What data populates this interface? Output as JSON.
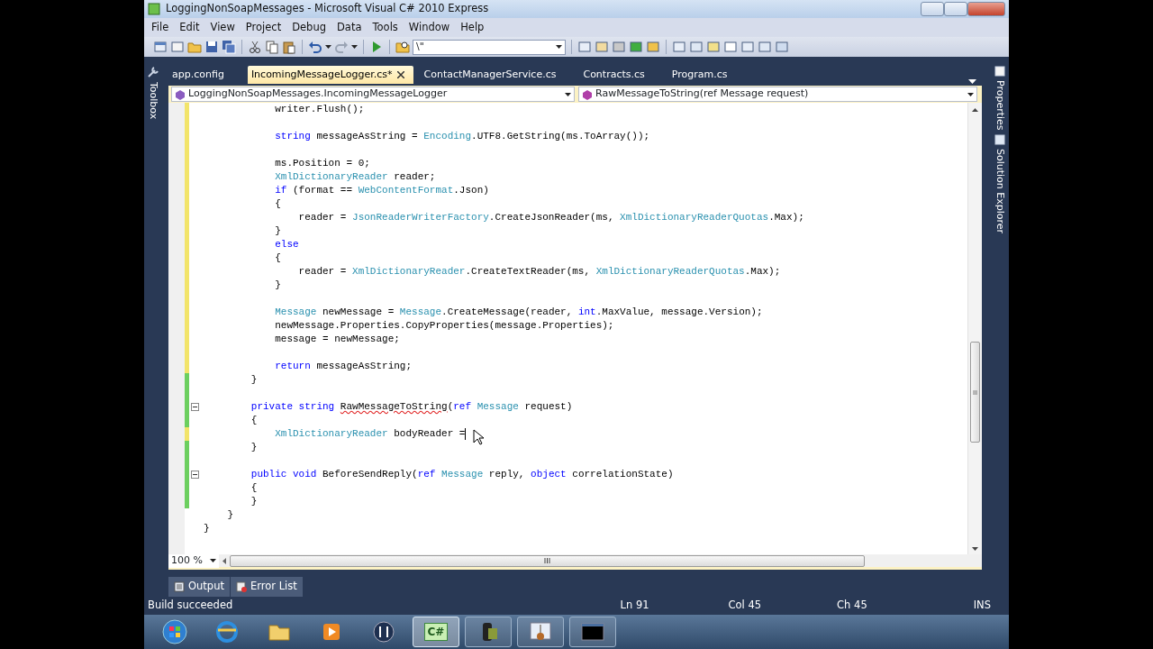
{
  "window": {
    "title": "LoggingNonSoapMessages - Microsoft Visual C# 2010 Express"
  },
  "menu": [
    "File",
    "Edit",
    "View",
    "Project",
    "Debug",
    "Data",
    "Tools",
    "Window",
    "Help"
  ],
  "toolbar": {
    "combo_value": "\\\""
  },
  "side_panels": {
    "left": [
      "Toolbox"
    ],
    "right": [
      "Properties",
      "Solution Explorer"
    ]
  },
  "doc_tabs": [
    {
      "label": "app.config",
      "selected": false
    },
    {
      "label": "IncomingMessageLogger.cs*",
      "selected": true
    },
    {
      "label": "ContactManagerService.cs",
      "selected": false
    },
    {
      "label": "Contracts.cs",
      "selected": false
    },
    {
      "label": "Program.cs",
      "selected": false
    }
  ],
  "nav_bar": {
    "type_dropdown": "LoggingNonSoapMessages.IncomingMessageLogger",
    "member_dropdown": "RawMessageToString(ref Message request)"
  },
  "code_lines": [
    {
      "modified": true,
      "saved": false,
      "tokens": [
        {
          "kind": "plain",
          "text": "            writer.Flush();"
        }
      ]
    },
    {
      "modified": true,
      "saved": false
    },
    {
      "modified": true,
      "saved": false,
      "tokens": [
        {
          "kind": "keyword",
          "text": "            string"
        },
        {
          "kind": "plain",
          "text": " messageAsString = "
        },
        {
          "kind": "type",
          "text": "Encoding"
        },
        {
          "kind": "plain",
          "text": ".UTF8.GetString(ms.ToArray());"
        }
      ]
    },
    {
      "modified": true,
      "saved": false
    },
    {
      "modified": true,
      "saved": false,
      "tokens": [
        {
          "kind": "plain",
          "text": "            ms.Position = 0;"
        }
      ]
    },
    {
      "modified": true,
      "saved": false,
      "tokens": [
        {
          "kind": "type",
          "text": "            XmlDictionaryReader"
        },
        {
          "kind": "plain",
          "text": " reader;"
        }
      ]
    },
    {
      "modified": true,
      "saved": false,
      "tokens": [
        {
          "kind": "keyword",
          "text": "            if"
        },
        {
          "kind": "plain",
          "text": " (format == "
        },
        {
          "kind": "type",
          "text": "WebContentFormat"
        },
        {
          "kind": "plain",
          "text": ".Json)"
        }
      ]
    },
    {
      "modified": true,
      "saved": false,
      "tokens": [
        {
          "kind": "plain",
          "text": "            {"
        }
      ]
    },
    {
      "modified": true,
      "saved": false,
      "tokens": [
        {
          "kind": "plain",
          "text": "                reader = "
        },
        {
          "kind": "type",
          "text": "JsonReaderWriterFactory"
        },
        {
          "kind": "plain",
          "text": ".CreateJsonReader(ms, "
        },
        {
          "kind": "type",
          "text": "XmlDictionaryReaderQuotas"
        },
        {
          "kind": "plain",
          "text": ".Max);"
        }
      ]
    },
    {
      "modified": true,
      "saved": false,
      "tokens": [
        {
          "kind": "plain",
          "text": "            }"
        }
      ]
    },
    {
      "modified": true,
      "saved": false,
      "tokens": [
        {
          "kind": "keyword",
          "text": "            else"
        }
      ]
    },
    {
      "modified": true,
      "saved": false,
      "tokens": [
        {
          "kind": "plain",
          "text": "            {"
        }
      ]
    },
    {
      "modified": true,
      "saved": false,
      "tokens": [
        {
          "kind": "plain",
          "text": "                reader = "
        },
        {
          "kind": "type",
          "text": "XmlDictionaryReader"
        },
        {
          "kind": "plain",
          "text": ".CreateTextReader(ms, "
        },
        {
          "kind": "type",
          "text": "XmlDictionaryReaderQuotas"
        },
        {
          "kind": "plain",
          "text": ".Max);"
        }
      ]
    },
    {
      "modified": true,
      "saved": false,
      "tokens": [
        {
          "kind": "plain",
          "text": "            }"
        }
      ]
    },
    {
      "modified": true,
      "saved": false
    },
    {
      "modified": true,
      "saved": false,
      "tokens": [
        {
          "kind": "type",
          "text": "            Message"
        },
        {
          "kind": "plain",
          "text": " newMessage = "
        },
        {
          "kind": "type",
          "text": "Message"
        },
        {
          "kind": "plain",
          "text": ".CreateMessage(reader, "
        },
        {
          "kind": "keyword",
          "text": "int"
        },
        {
          "kind": "plain",
          "text": ".MaxValue, message.Version);"
        }
      ]
    },
    {
      "modified": true,
      "saved": false,
      "tokens": [
        {
          "kind": "plain",
          "text": "            newMessage.Properties.CopyProperties(message.Properties);"
        }
      ]
    },
    {
      "modified": true,
      "saved": false,
      "tokens": [
        {
          "kind": "plain",
          "text": "            message = newMessage;"
        }
      ]
    },
    {
      "modified": true,
      "saved": false
    },
    {
      "modified": true,
      "saved": false,
      "tokens": [
        {
          "kind": "keyword",
          "text": "            return"
        },
        {
          "kind": "plain",
          "text": " messageAsString;"
        }
      ]
    },
    {
      "modified": true,
      "saved": true,
      "tokens": [
        {
          "kind": "plain",
          "text": "        }"
        }
      ]
    },
    {
      "modified": true,
      "saved": true
    },
    {
      "modified": true,
      "saved": true,
      "fold": true,
      "tokens": [
        {
          "kind": "keyword",
          "text": "        private string "
        },
        {
          "kind": "error",
          "text": "RawMessageToString"
        },
        {
          "kind": "plain",
          "text": "("
        },
        {
          "kind": "keyword",
          "text": "ref "
        },
        {
          "kind": "type",
          "text": "Message"
        },
        {
          "kind": "plain",
          "text": " request)"
        }
      ]
    },
    {
      "modified": true,
      "saved": true,
      "tokens": [
        {
          "kind": "plain",
          "text": "        {"
        }
      ]
    },
    {
      "modified": true,
      "saved": false,
      "caret": true,
      "tokens": [
        {
          "kind": "type",
          "text": "            XmlDictionaryReader"
        },
        {
          "kind": "plain",
          "text": " bodyReader ="
        }
      ]
    },
    {
      "modified": true,
      "saved": true,
      "tokens": [
        {
          "kind": "plain",
          "text": "        }"
        }
      ]
    },
    {
      "modified": true,
      "saved": true
    },
    {
      "modified": true,
      "saved": true,
      "fold": true,
      "tokens": [
        {
          "kind": "keyword",
          "text": "        public void"
        },
        {
          "kind": "plain",
          "text": " BeforeSendReply("
        },
        {
          "kind": "keyword",
          "text": "ref "
        },
        {
          "kind": "type",
          "text": "Message"
        },
        {
          "kind": "plain",
          "text": " reply, "
        },
        {
          "kind": "keyword",
          "text": "object"
        },
        {
          "kind": "plain",
          "text": " correlationState)"
        }
      ]
    },
    {
      "modified": true,
      "saved": true,
      "tokens": [
        {
          "kind": "plain",
          "text": "        {"
        }
      ]
    },
    {
      "modified": true,
      "saved": true,
      "tokens": [
        {
          "kind": "plain",
          "text": "        }"
        }
      ]
    },
    {
      "tokens": [
        {
          "kind": "plain",
          "text": "    }"
        }
      ]
    },
    {
      "tokens": [
        {
          "kind": "plain",
          "text": "}"
        }
      ]
    }
  ],
  "editor_footer": {
    "zoom": "100 %"
  },
  "output_tabs": [
    {
      "label": "Output"
    },
    {
      "label": "Error List"
    }
  ],
  "status_bar": {
    "message": "Build succeeded",
    "line": "Ln 91",
    "column": "Col 45",
    "char": "Ch 45",
    "mode": "INS"
  },
  "taskbar": [
    {
      "kind": "start"
    },
    {
      "kind": "browser",
      "open": false
    },
    {
      "kind": "folder",
      "open": false
    },
    {
      "kind": "media",
      "open": false
    },
    {
      "kind": "hp",
      "open": false
    },
    {
      "kind": "csharp",
      "label": "C#",
      "open": true,
      "selected": true
    },
    {
      "kind": "camera",
      "open": true,
      "selected": false
    },
    {
      "kind": "guitar",
      "open": true,
      "selected": false
    },
    {
      "kind": "console",
      "open": true,
      "selected": false
    }
  ]
}
